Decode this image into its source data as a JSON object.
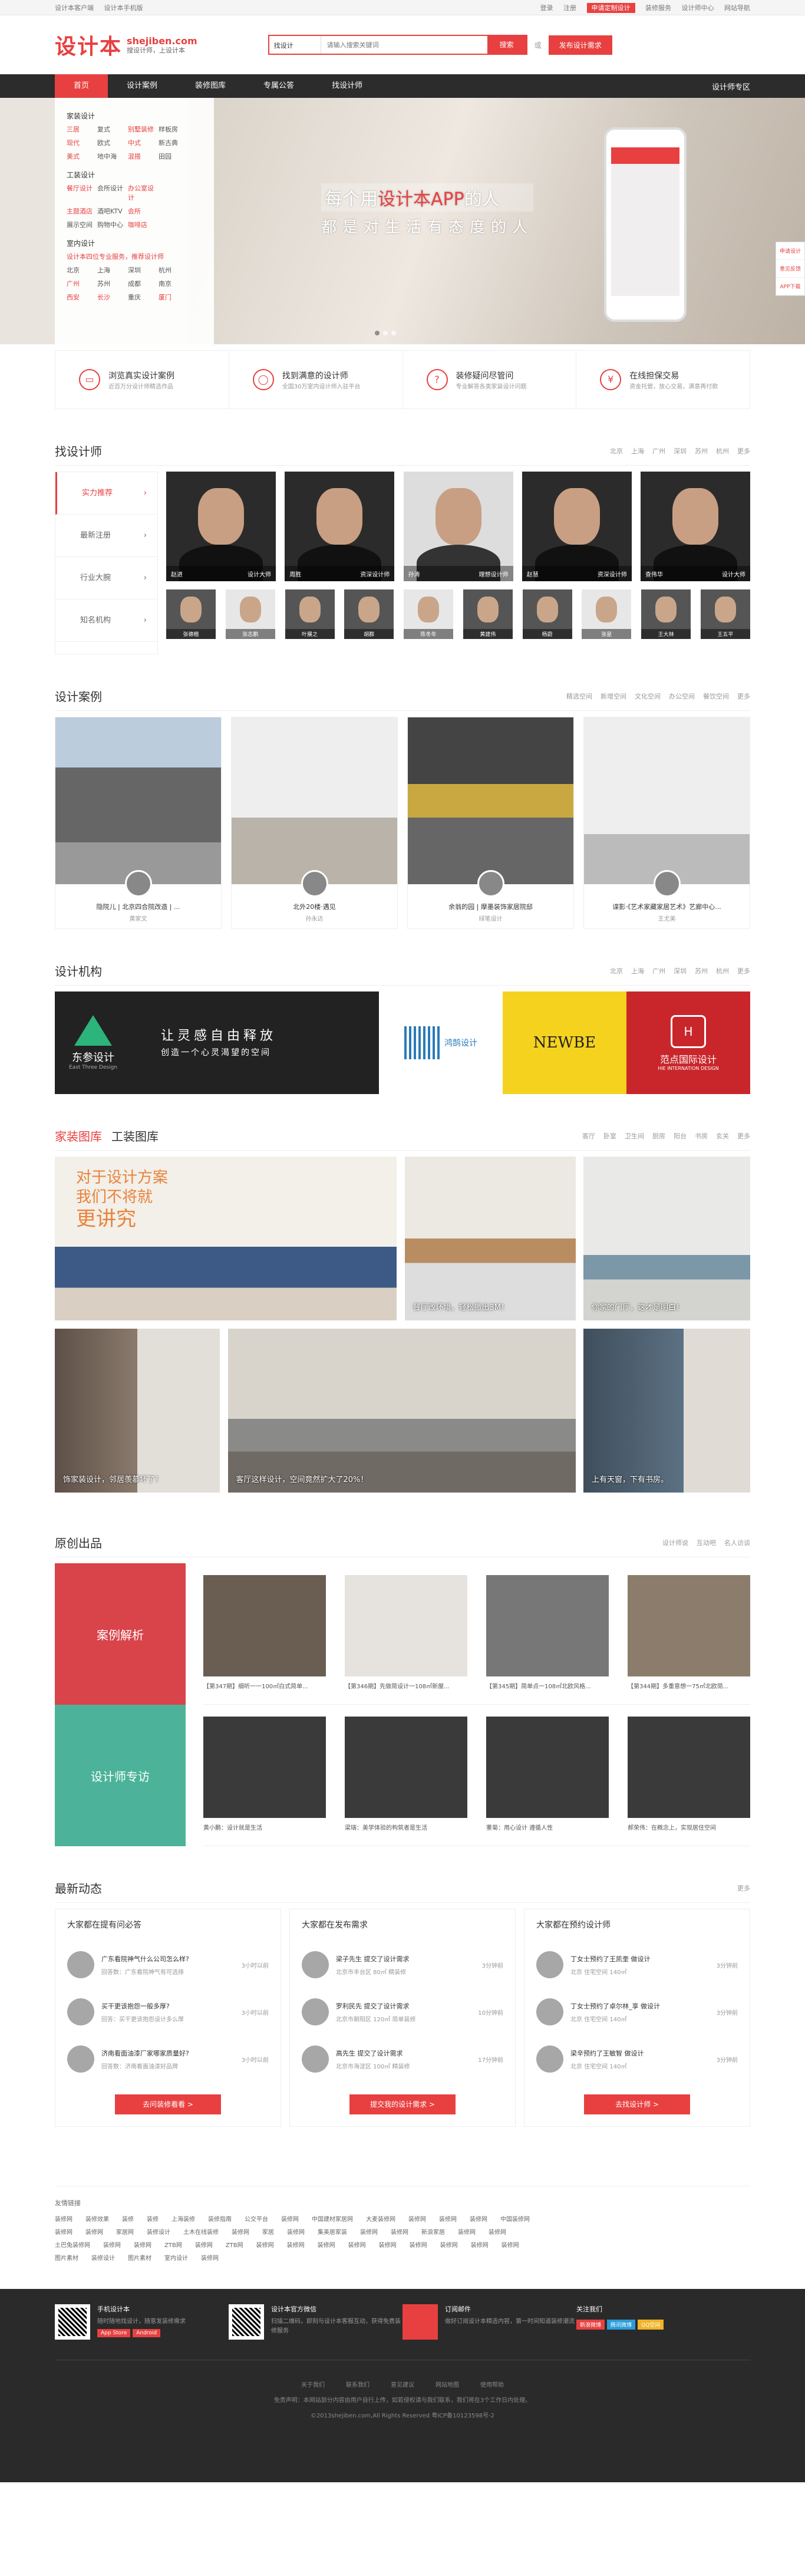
{
  "topbar": {
    "left": [
      "设计本客户端",
      "设计本手机版"
    ],
    "right": [
      "登录",
      "注册",
      "申请定制设计",
      "装修服务",
      "设计师中心",
      "网站导航"
    ]
  },
  "header": {
    "logo_cn": "设计本",
    "logo_en": "shejiben.com",
    "tagline": "搜设计师，上设计本",
    "search_select": "找设计",
    "search_placeholder": "请输入搜索关键词",
    "search_btn": "搜索",
    "or": "或",
    "request_btn": "发布设计需求"
  },
  "nav": {
    "items": [
      "首页",
      "设计案例",
      "装修图库",
      "专属公答",
      "找设计师"
    ],
    "right": "设计师专区"
  },
  "banner": {
    "slogan1_pre": "每个用",
    "slogan1_em": "设计本APP",
    "slogan1_post": "的人",
    "slogan2": "都是对生活有态度的人"
  },
  "sidemenu": {
    "groups": [
      {
        "title": "家装设计",
        "items": [
          {
            "t": "三居",
            "red": true
          },
          {
            "t": "复式",
            "red": false
          },
          {
            "t": "别墅装修",
            "red": true
          },
          {
            "t": "样板房",
            "red": false
          },
          {
            "t": "现代",
            "red": true
          },
          {
            "t": "欧式",
            "red": false
          },
          {
            "t": "中式",
            "red": true
          },
          {
            "t": "新古典",
            "red": false
          },
          {
            "t": "美式",
            "red": true
          },
          {
            "t": "地中海",
            "red": false
          },
          {
            "t": "混搭",
            "red": true
          },
          {
            "t": "田园",
            "red": false
          }
        ]
      },
      {
        "title": "工装设计",
        "items": [
          {
            "t": "餐厅设计",
            "red": true
          },
          {
            "t": "会所设计",
            "red": false
          },
          {
            "t": "办公室设计",
            "red": true
          },
          {
            "t": "",
            "red": false
          },
          {
            "t": "主题酒店",
            "red": true
          },
          {
            "t": "酒吧KTV",
            "red": false
          },
          {
            "t": "会所",
            "red": true
          },
          {
            "t": "",
            "red": false
          },
          {
            "t": "展示空间",
            "red": false
          },
          {
            "t": "购物中心",
            "red": false
          },
          {
            "t": "咖啡店",
            "red": true
          },
          {
            "t": "",
            "red": false
          }
        ]
      },
      {
        "title": "室内设计",
        "items": [
          {
            "t": "设计本四位专业服务，推荐设计师",
            "red": true
          },
          {
            "t": "北京",
            "red": false
          },
          {
            "t": "上海",
            "red": false
          },
          {
            "t": "深圳",
            "red": false
          },
          {
            "t": "杭州",
            "red": false
          },
          {
            "t": "广州",
            "red": true
          },
          {
            "t": "苏州",
            "red": false
          },
          {
            "t": "成都",
            "red": false
          },
          {
            "t": "南京",
            "red": false
          },
          {
            "t": "西安",
            "red": true
          },
          {
            "t": "长沙",
            "red": true
          },
          {
            "t": "重庆",
            "red": false
          },
          {
            "t": "厦门",
            "red": true
          }
        ]
      }
    ]
  },
  "float": [
    "申请设计",
    "意见反馈",
    "APP下载"
  ],
  "features": [
    {
      "icon": "doc-icon",
      "glyph": "▭",
      "title": "浏览真实设计案例",
      "sub": "近百万分设计师精选作品"
    },
    {
      "icon": "user-icon",
      "glyph": "◯",
      "title": "找到满意的设计师",
      "sub": "全国30万室内设计师入驻平台"
    },
    {
      "icon": "question-icon",
      "glyph": "?",
      "title": "装修疑问尽管问",
      "sub": "专业解答各类家装设计问题"
    },
    {
      "icon": "shield-icon",
      "glyph": "¥",
      "title": "在线担保交易",
      "sub": "资金托管，放心交易，满意再付款"
    }
  ],
  "designers": {
    "title": "找设计师",
    "cities": [
      "北京",
      "上海",
      "广州",
      "深圳",
      "苏州",
      "杭州",
      "更多"
    ],
    "tabs": [
      "实力推荐",
      "最新注册",
      "行业大腕",
      "知名机构"
    ],
    "big": [
      {
        "name": "赵进",
        "tag": "设计大师"
      },
      {
        "name": "周胜",
        "tag": "资深设计师"
      },
      {
        "name": "孙涛",
        "tag": "理想设计师"
      },
      {
        "name": "赵慧",
        "tag": "资深设计师"
      },
      {
        "name": "查伟华",
        "tag": "设计大师"
      }
    ],
    "small": [
      "张德楷",
      "张志鹏",
      "叶展之",
      "胡群",
      "陈冬年",
      "黄建伟",
      "杨蔚",
      "张星",
      "王大林",
      "王五平"
    ]
  },
  "cases": {
    "title": "设计案例",
    "tabs": [
      "精选空间",
      "新增空间",
      "文化空间",
      "办公空间",
      "餐饮空间",
      "更多"
    ],
    "items": [
      {
        "title": "隐院儿 | 北京四合院改造 | ...",
        "author": "黄家文"
      },
      {
        "title": "北外20楼·遇见",
        "author": "孙永达"
      },
      {
        "title": "余翁的园 | 摩墨装饰家居院邸",
        "author": "绿笔设计"
      },
      {
        "title": "谍影·《艺术家藏家居艺术》艺廊中心...",
        "author": "王尤美"
      }
    ]
  },
  "orgs": {
    "title": "设计机构",
    "tabs": [
      "北京",
      "上海",
      "广州",
      "深圳",
      "苏州",
      "杭州",
      "更多"
    ],
    "org1_name": "东参设计",
    "org1_en": "East Three Design",
    "org1_slogan1": "让灵感自由释放",
    "org1_slogan2": "创造一个心灵渴望的空间",
    "org2_name": "鸿鹄设计",
    "org3_name": "NEWBE",
    "org4_name": "范点国际设计",
    "org4_en": "HIE INTERNATION DESIGN"
  },
  "gallery": {
    "tab1": "家装图库",
    "tab2": "工装图库",
    "filters": [
      "客厅",
      "卧室",
      "卫生间",
      "厨房",
      "阳台",
      "书房",
      "玄关",
      "更多"
    ],
    "quote1": "对于设计方案",
    "quote2": "我们不将就",
    "quote3": "更讲究",
    "caps": [
      "",
      "餐厅改环境，轻松撒出3M！",
      "你家的门厅，这才是明白！",
      "饰家装设计，邻居羡慕坏了！",
      "客厅这样设计，空间竟然扩大了20%！",
      "上有天窗，下有书房。"
    ]
  },
  "original": {
    "title": "原创出品",
    "tabs": [
      "设计师说",
      "互动吧",
      "名人访谈"
    ],
    "left1": "案例解析",
    "left2": "设计师专访",
    "row1": [
      "【第347期】细听一一100㎡白式简单...",
      "【第346期】先做简设计一108㎡新屋...",
      "【第345期】简单点一108㎡北欧风格...",
      "【第344期】多重意想一75㎡北欧简..."
    ],
    "row2": [
      "黄小鹏：设计就是生活",
      "梁瑞：美学体验的构筑者是生活",
      "董菊：用心设计 遵循人性",
      "郝荣伟：在概念上，实现居住空间"
    ]
  },
  "news": {
    "title": "最新动态",
    "more": "更多",
    "cols": [
      {
        "title": "大家都在提有问必答",
        "btn": "去问装修看看 >",
        "items": [
          {
            "t": "广东看院神气什么公司怎么样?",
            "s": "回答数：广东看院神气有可选择",
            "tm": "3小时以前"
          },
          {
            "t": "买干更该抱怨一般多厚?",
            "s": "回答：买干更该抱怨设计多么厚",
            "tm": "3小时以前"
          },
          {
            "t": "济南看面油漆厂家哪家质量好?",
            "s": "回答数：济南看面油漆好品牌",
            "tm": "3小时以前"
          }
        ]
      },
      {
        "title": "大家都在发布需求",
        "btn": "提交我的设计需求 >",
        "items": [
          {
            "t": "梁子先生 提交了设计需求",
            "s": "北京市丰台区 80㎡ 精装修",
            "tm": "3分钟前"
          },
          {
            "t": "罗利民先 提交了设计需求",
            "s": "北京市朝阳区 120㎡ 简单装修",
            "tm": "10分钟前"
          },
          {
            "t": "高先生 提交了设计需求",
            "s": "北京市海淀区 100㎡ 精装修",
            "tm": "17分钟前"
          }
        ]
      },
      {
        "title": "大家都在预约设计师",
        "btn": "去找设计师 >",
        "items": [
          {
            "t": "丁女士预约了王凯奎 做设计",
            "s": "北京  住宅空间  140㎡",
            "tm": "3分钟前"
          },
          {
            "t": "丁女士预约了卓尔林_享 做设计",
            "s": "北京  住宅空间  140㎡",
            "tm": "3分钟前"
          },
          {
            "t": "梁辛预约了王敏智 做设计",
            "s": "北京  住宅空间  140㎡",
            "tm": "3分钟前"
          }
        ]
      }
    ]
  },
  "links": {
    "title": "友情链接",
    "rows": [
      "装修网  装修效果  装修  装修  上海装修  装修指南  公交平台  装修网  中国建材家居网  大麦装修网  装修网  装修网  装修网  中国装修网",
      "装修网  装修网  家居网  装修设计  土木在线装修  装修网  家居  装修网  集美居家装  装修网  装修网  新浪家居  装修网  装修网",
      "土巴兔装修网  装修网  装修网  ZTB网  装修网  ZTB网  装修网  装修网  装修网  装修网  装修网  装修网  装修网  装修网  装修网",
      "图片素材  装修设计  图片素材  室内设计  装修网"
    ]
  },
  "footer": {
    "cols": [
      {
        "title": "手机设计本",
        "sub": "随时随地找设计，随意发装修需求",
        "badges": [
          "App Store",
          "Android"
        ]
      },
      {
        "title": "设计本官方微信",
        "sub": "扫描二维码，即刻与设计本客服互动，获得免费装修服务"
      },
      {
        "title": "订阅邮件",
        "sub": "做好订阅设计本精选内容，第一时间知道装修潮流"
      },
      {
        "title": "关注我们",
        "badges": [
          "新浪微博",
          "腾讯微博",
          "QQ空间"
        ]
      }
    ],
    "links": [
      "关于我们",
      "联系我们",
      "意见建议",
      "网站地图",
      "使用帮助"
    ],
    "disclaimer": "免责声明：本网站部分内容由用户自行上传，如若侵权请与我们联系，我们将在3个工作日内处理。",
    "copyright": "©2013shejiben.com,All Rights Reserved 粤ICP备10123598号-2"
  },
  "colors": {
    "accent": "#e84040",
    "dark": "#2c2c2c"
  }
}
